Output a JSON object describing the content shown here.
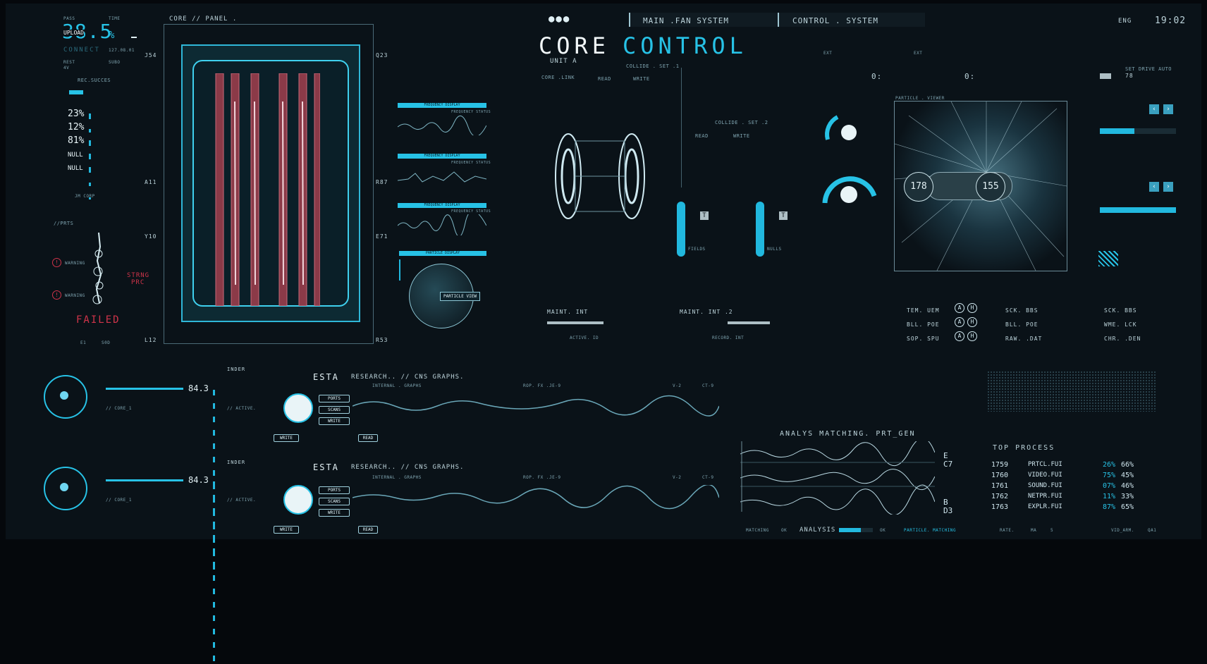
{
  "header": {
    "dots": "●●●",
    "tab1": "MAIN .FAN SYSTEM",
    "tab2": "CONTROL . SYSTEM",
    "lang": "ENG",
    "time": "19:02"
  },
  "title": {
    "word1": "CORE",
    "word2": "CONTROL",
    "sub": "UNIT A",
    "link": "CORE .LINK"
  },
  "left": {
    "pass": "PASS",
    "time": "TIME",
    "big": "38.5",
    "pct": "%",
    "upload": "UPLOAD",
    "connect": "CONNECT",
    "ip": "127.08.01",
    "rest": "REST",
    "rest_v": "4V",
    "subo": "SUBO",
    "rec": "REC.SUCCES",
    "stats": [
      {
        "v": "23%"
      },
      {
        "v": "12%"
      },
      {
        "v": "81%"
      },
      {
        "v": "NULL"
      },
      {
        "v": "NULL"
      }
    ],
    "jm": "JM CORP",
    "prts": "//PRTS",
    "warning": "WARNING",
    "strng": "STRNG",
    "prc": "PRC",
    "failed": "FAILED",
    "e1": "E1",
    "s0": "S0D"
  },
  "panel": {
    "title": "CORE // PANEL .",
    "labels": [
      "J54",
      "Q23",
      "A11",
      "R87",
      "Y10",
      "E71",
      "L12",
      "R53"
    ]
  },
  "freq": {
    "header": "FREQUENCY DISPLAY",
    "sub": "FREQUENCY STATUS",
    "particle": "PARTICLE DISPLAY",
    "view": "PARTICLE VIEW"
  },
  "collide": {
    "a": "COLLIDE . SET .1",
    "b": "COLLIDE . SET .2",
    "read": "READ",
    "write": "WRITE",
    "fields": "FIELDS",
    "nulls": "NULLS",
    "t": "T"
  },
  "maint": {
    "a": "MAINT. INT",
    "b": "MAINT. INT .2",
    "active": "ACTIVE. ID",
    "record": "RECORD. INT"
  },
  "right": {
    "ext": "EXT",
    "zero": "0:",
    "particle": "PARTICLE . VIEWER",
    "n1": "178",
    "n2": "155",
    "setdrive": "SET DRIVE AUTO",
    "sd_val": "78",
    "tags": [
      "TEM. UEM",
      "BLL. POE",
      "SOP. SPU",
      "SCK. BBS",
      "BLL. POE",
      "RAW. .DAT",
      "SCK. BBS",
      "WME. LCK",
      "CHR. .DEN"
    ],
    "btn_a": "A",
    "btn_h": "H"
  },
  "research": {
    "rows": [
      {
        "esta": "ESTA",
        "title": "RESEARCH.. // CNS GRAPHS.",
        "val": "84.3",
        "core": "// CORE_1",
        "active": "// ACTIVE.",
        "inder": "INDER"
      },
      {
        "esta": "ESTA",
        "title": "RESEARCH.. // CNS GRAPHS.",
        "val": "84.3",
        "core": "// CORE_1",
        "active": "// ACTIVE.",
        "inder": "INDER"
      }
    ],
    "ports": "PORTS",
    "scans": "SCANS",
    "write": "WRITE",
    "read": "READ",
    "graphs": "INTERNAL . GRAPHS",
    "rop": "ROP. FX .JE-9",
    "v2": "V-2",
    "ct": "CT-9"
  },
  "analysis": {
    "title": "ANALYS MATCHING. PRT_GEN",
    "c7": "C7",
    "d3": "D3",
    "e": "E",
    "b": "B",
    "matching": "MATCHING",
    "ok": "OK",
    "analysis": "ANALYSIS",
    "ok2": "OK",
    "pm": "PARTICLE. MATCHING"
  },
  "top_process": {
    "title": "TOP PROCESS",
    "rows": [
      {
        "id": "1759",
        "name": "PRTCL.FUI",
        "a": "26%",
        "b": "66%"
      },
      {
        "id": "1760",
        "name": "VIDEO.FUI",
        "a": "75%",
        "b": "45%"
      },
      {
        "id": "1761",
        "name": "SOUND.FUI",
        "a": "07%",
        "b": "46%"
      },
      {
        "id": "1762",
        "name": "NETPR.FUI",
        "a": "11%",
        "b": "33%"
      },
      {
        "id": "1763",
        "name": "EXPLR.FUI",
        "a": "87%",
        "b": "65%"
      }
    ],
    "rate": "RATE.",
    "ma": "MA",
    "five": "5",
    "vid": "VID_ARM.",
    "qa": "QA1"
  },
  "colors": {
    "accent": "#27c2e6",
    "alert": "#d0344a",
    "bg": "#0a1218"
  }
}
